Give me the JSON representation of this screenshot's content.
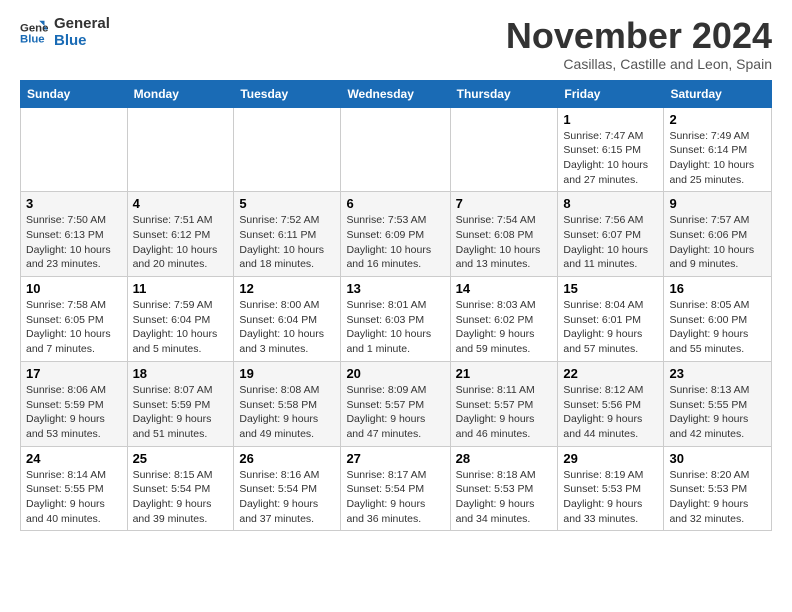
{
  "header": {
    "logo_line1": "General",
    "logo_line2": "Blue",
    "month_title": "November 2024",
    "subtitle": "Casillas, Castille and Leon, Spain"
  },
  "days_of_week": [
    "Sunday",
    "Monday",
    "Tuesday",
    "Wednesday",
    "Thursday",
    "Friday",
    "Saturday"
  ],
  "weeks": [
    [
      {
        "day": "",
        "info": ""
      },
      {
        "day": "",
        "info": ""
      },
      {
        "day": "",
        "info": ""
      },
      {
        "day": "",
        "info": ""
      },
      {
        "day": "",
        "info": ""
      },
      {
        "day": "1",
        "info": "Sunrise: 7:47 AM\nSunset: 6:15 PM\nDaylight: 10 hours\nand 27 minutes."
      },
      {
        "day": "2",
        "info": "Sunrise: 7:49 AM\nSunset: 6:14 PM\nDaylight: 10 hours\nand 25 minutes."
      }
    ],
    [
      {
        "day": "3",
        "info": "Sunrise: 7:50 AM\nSunset: 6:13 PM\nDaylight: 10 hours\nand 23 minutes."
      },
      {
        "day": "4",
        "info": "Sunrise: 7:51 AM\nSunset: 6:12 PM\nDaylight: 10 hours\nand 20 minutes."
      },
      {
        "day": "5",
        "info": "Sunrise: 7:52 AM\nSunset: 6:11 PM\nDaylight: 10 hours\nand 18 minutes."
      },
      {
        "day": "6",
        "info": "Sunrise: 7:53 AM\nSunset: 6:09 PM\nDaylight: 10 hours\nand 16 minutes."
      },
      {
        "day": "7",
        "info": "Sunrise: 7:54 AM\nSunset: 6:08 PM\nDaylight: 10 hours\nand 13 minutes."
      },
      {
        "day": "8",
        "info": "Sunrise: 7:56 AM\nSunset: 6:07 PM\nDaylight: 10 hours\nand 11 minutes."
      },
      {
        "day": "9",
        "info": "Sunrise: 7:57 AM\nSunset: 6:06 PM\nDaylight: 10 hours\nand 9 minutes."
      }
    ],
    [
      {
        "day": "10",
        "info": "Sunrise: 7:58 AM\nSunset: 6:05 PM\nDaylight: 10 hours\nand 7 minutes."
      },
      {
        "day": "11",
        "info": "Sunrise: 7:59 AM\nSunset: 6:04 PM\nDaylight: 10 hours\nand 5 minutes."
      },
      {
        "day": "12",
        "info": "Sunrise: 8:00 AM\nSunset: 6:04 PM\nDaylight: 10 hours\nand 3 minutes."
      },
      {
        "day": "13",
        "info": "Sunrise: 8:01 AM\nSunset: 6:03 PM\nDaylight: 10 hours\nand 1 minute."
      },
      {
        "day": "14",
        "info": "Sunrise: 8:03 AM\nSunset: 6:02 PM\nDaylight: 9 hours\nand 59 minutes."
      },
      {
        "day": "15",
        "info": "Sunrise: 8:04 AM\nSunset: 6:01 PM\nDaylight: 9 hours\nand 57 minutes."
      },
      {
        "day": "16",
        "info": "Sunrise: 8:05 AM\nSunset: 6:00 PM\nDaylight: 9 hours\nand 55 minutes."
      }
    ],
    [
      {
        "day": "17",
        "info": "Sunrise: 8:06 AM\nSunset: 5:59 PM\nDaylight: 9 hours\nand 53 minutes."
      },
      {
        "day": "18",
        "info": "Sunrise: 8:07 AM\nSunset: 5:59 PM\nDaylight: 9 hours\nand 51 minutes."
      },
      {
        "day": "19",
        "info": "Sunrise: 8:08 AM\nSunset: 5:58 PM\nDaylight: 9 hours\nand 49 minutes."
      },
      {
        "day": "20",
        "info": "Sunrise: 8:09 AM\nSunset: 5:57 PM\nDaylight: 9 hours\nand 47 minutes."
      },
      {
        "day": "21",
        "info": "Sunrise: 8:11 AM\nSunset: 5:57 PM\nDaylight: 9 hours\nand 46 minutes."
      },
      {
        "day": "22",
        "info": "Sunrise: 8:12 AM\nSunset: 5:56 PM\nDaylight: 9 hours\nand 44 minutes."
      },
      {
        "day": "23",
        "info": "Sunrise: 8:13 AM\nSunset: 5:55 PM\nDaylight: 9 hours\nand 42 minutes."
      }
    ],
    [
      {
        "day": "24",
        "info": "Sunrise: 8:14 AM\nSunset: 5:55 PM\nDaylight: 9 hours\nand 40 minutes."
      },
      {
        "day": "25",
        "info": "Sunrise: 8:15 AM\nSunset: 5:54 PM\nDaylight: 9 hours\nand 39 minutes."
      },
      {
        "day": "26",
        "info": "Sunrise: 8:16 AM\nSunset: 5:54 PM\nDaylight: 9 hours\nand 37 minutes."
      },
      {
        "day": "27",
        "info": "Sunrise: 8:17 AM\nSunset: 5:54 PM\nDaylight: 9 hours\nand 36 minutes."
      },
      {
        "day": "28",
        "info": "Sunrise: 8:18 AM\nSunset: 5:53 PM\nDaylight: 9 hours\nand 34 minutes."
      },
      {
        "day": "29",
        "info": "Sunrise: 8:19 AM\nSunset: 5:53 PM\nDaylight: 9 hours\nand 33 minutes."
      },
      {
        "day": "30",
        "info": "Sunrise: 8:20 AM\nSunset: 5:53 PM\nDaylight: 9 hours\nand 32 minutes."
      }
    ]
  ]
}
